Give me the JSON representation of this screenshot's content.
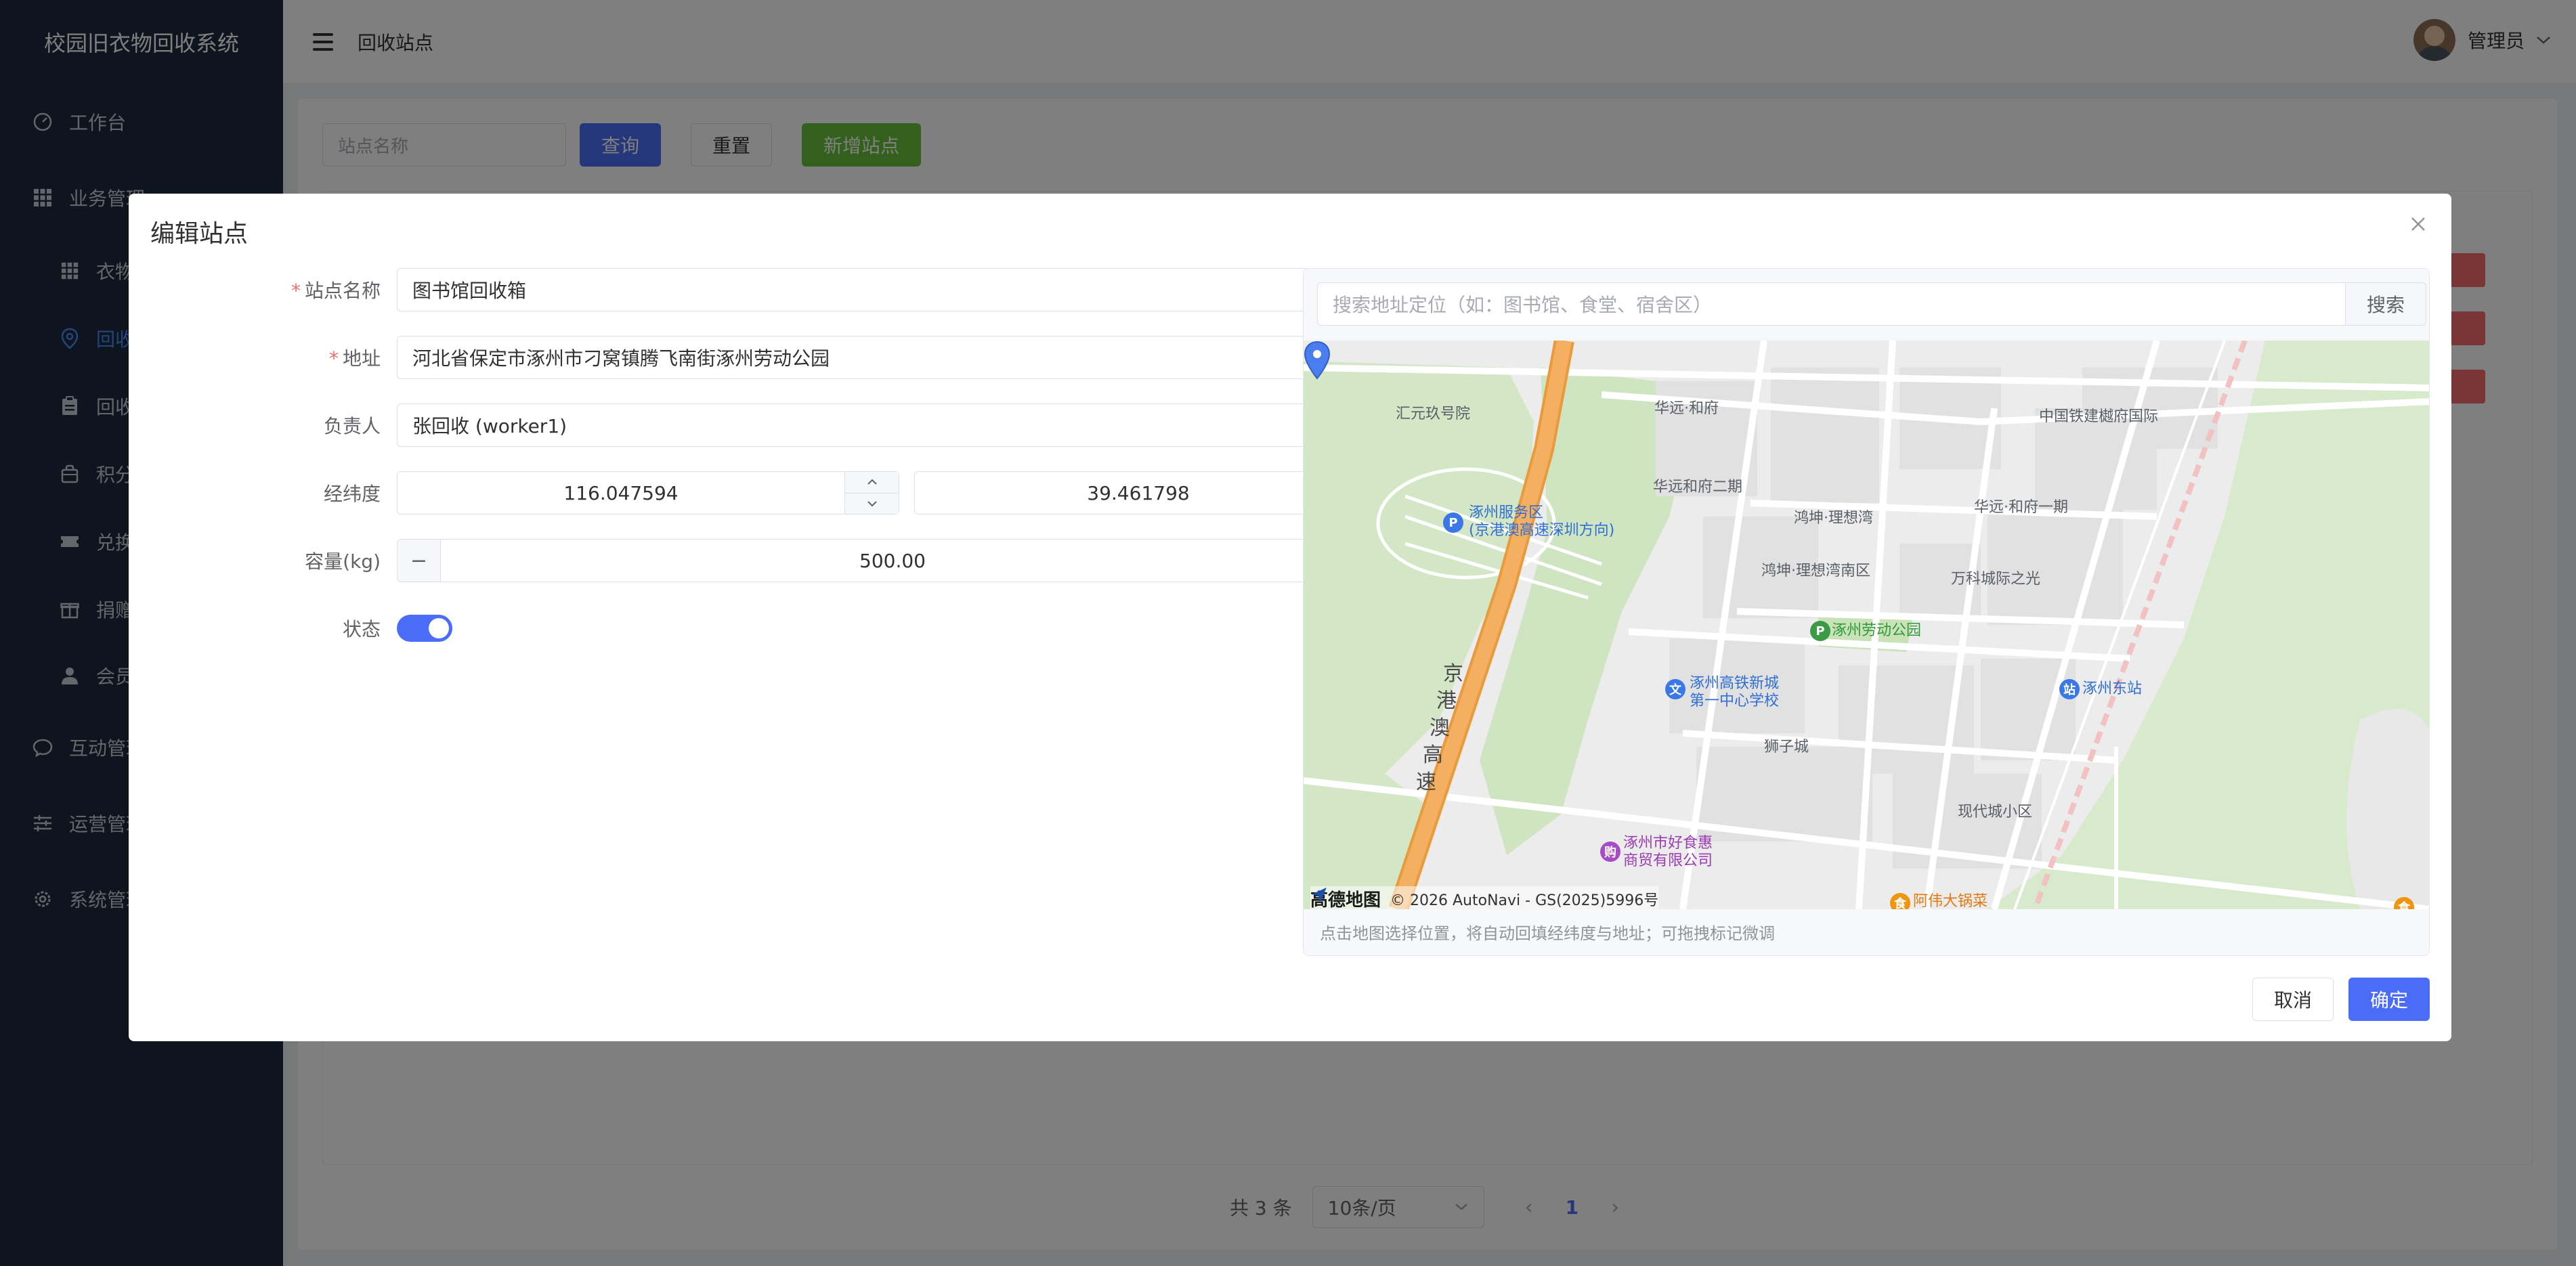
{
  "app": {
    "title": "校园旧衣物回收系统"
  },
  "sidebar": {
    "items": [
      {
        "label": "工作台",
        "icon": "dashboard-icon"
      },
      {
        "label": "业务管理",
        "icon": "grid-icon"
      },
      {
        "label": "衣物",
        "icon": "grid-icon"
      },
      {
        "label": "回收",
        "icon": "location-icon"
      },
      {
        "label": "回收",
        "icon": "clipboard-icon"
      },
      {
        "label": "积分",
        "icon": "bag-icon"
      },
      {
        "label": "兑换",
        "icon": "ticket-icon"
      },
      {
        "label": "捐赠",
        "icon": "gift-icon"
      },
      {
        "label": "会员",
        "icon": "user-icon"
      },
      {
        "label": "互动管理",
        "icon": "chat-icon"
      },
      {
        "label": "运营管理",
        "icon": "sliders-icon"
      },
      {
        "label": "系统管理",
        "icon": "gear-icon"
      }
    ]
  },
  "header": {
    "breadcrumb": "回收站点",
    "user_name": "管理员"
  },
  "page": {
    "search_placeholder": "站点名称",
    "query_label": "查询",
    "reset_label": "重置",
    "add_label": "新增站点",
    "pagination": {
      "total": "共 3 条",
      "page_size": "10条/页",
      "current": "1"
    }
  },
  "dialog": {
    "title": "编辑站点",
    "fields": {
      "name_label": "站点名称",
      "name_value": "图书馆回收箱",
      "address_label": "地址",
      "address_value": "河北省保定市涿州市刁窝镇腾飞南街涿州劳动公园",
      "owner_label": "负责人",
      "owner_value": "张回收 (worker1)",
      "coord_label": "经纬度",
      "lng_value": "116.047594",
      "lat_value": "39.461798",
      "capacity_label": "容量(kg)",
      "capacity_value": "500.00",
      "status_label": "状态",
      "status_on": true
    },
    "map": {
      "search_placeholder": "搜索地址定位（如：图书馆、食堂、宿舍区）",
      "search_label": "搜索",
      "labels": {
        "huiyuan": "汇元玖号院",
        "huayuan_he": "华远·和府",
        "zhongtie": "中国铁建樾府国际",
        "fuwuqu_1": "涿州服务区",
        "fuwuqu_2": "(京港澳高速深圳方向)",
        "hefu_erqi": "华远和府二期",
        "lixiang_wan": "鸿坤·理想湾",
        "hefu_yiqi": "华远·和府一期",
        "lixiang_nan": "鸿坤·理想湾南区",
        "wanke": "万科城际之光",
        "laodong_park": "涿州劳动公园",
        "gaotie_school_1": "涿州高铁新城",
        "gaotie_school_2": "第一中心学校",
        "dongzhan": "涿州东站",
        "shizicheng": "狮子城",
        "xiandai": "现代城小区",
        "jinggang_1": "京",
        "jinggang_2": "港",
        "jinggang_3": "澳",
        "jinggang_4": "高",
        "jinggang_5": "速",
        "haoshihui_1": "涿州市好食惠",
        "haoshihui_2": "商贸有限公司",
        "aweida": "阿伟大锅菜"
      },
      "logo": "高德地图",
      "copyright": "© 2026 AutoNavi - GS(2025)5996号",
      "hint": "点击地图选择位置，将自动回填经纬度与地址；可拖拽标记微调"
    },
    "cancel_label": "取消",
    "ok_label": "确定"
  },
  "colors": {
    "primary": "#4a6cf7",
    "success": "#67c23a",
    "danger": "#f56c6c",
    "sidebar_bg": "#1f2a3c"
  }
}
